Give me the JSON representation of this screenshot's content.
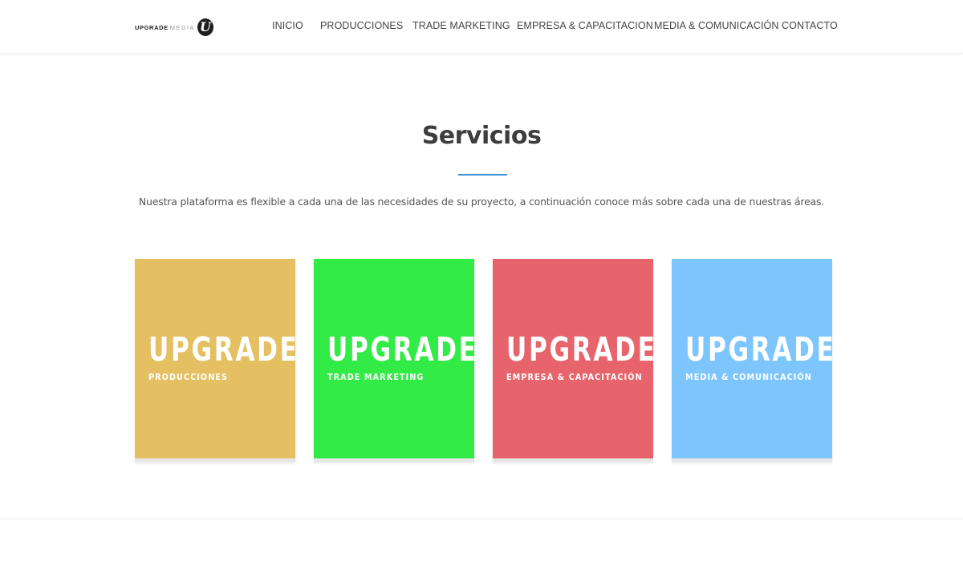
{
  "header": {
    "logo": {
      "word1": "UPGRADE",
      "word2": "MEDIA",
      "mark": "U"
    },
    "nav": [
      "INICIO",
      "PRODUCCIONES",
      "TRADE MARKETING",
      "EMPRESA & CAPACITACION",
      "MEDIA & COMUNICACIÓN",
      "CONTACTO"
    ]
  },
  "services": {
    "title": "Servicios",
    "description": "Nuestra plataforma es flexible a cada una de las necesidades de su proyecto, a continuación conoce más sobre cada una de nuestras áreas.",
    "cards": [
      {
        "brand": "UPGRADE",
        "subtitle": "PRODUCCIONES",
        "color": "#e5c062"
      },
      {
        "brand": "UPGRADE",
        "subtitle": "TRADE MARKETING",
        "color": "#33eb46"
      },
      {
        "brand": "UPGRADE",
        "subtitle": "EMPRESA & CAPACITACIÓN",
        "color": "#e8646c"
      },
      {
        "brand": "UPGRADE",
        "subtitle": "MEDIA & COMUNICACIÓN",
        "color": "#7dc6fd"
      }
    ]
  },
  "colors": {
    "accent": "#3a8fd6",
    "text": "#3d3d3d",
    "nav": "#444444"
  }
}
